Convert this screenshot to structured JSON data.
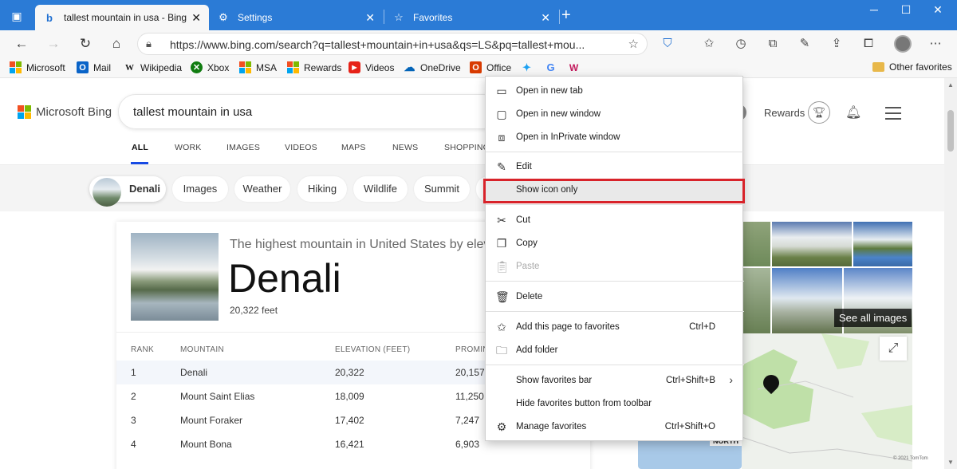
{
  "tabs": [
    {
      "title": "tallest mountain in usa - Bing",
      "icon": "bing-icon",
      "active": true
    },
    {
      "title": "Settings",
      "icon": "gear-icon",
      "active": false
    },
    {
      "title": "Favorites",
      "icon": "star-icon",
      "active": false
    }
  ],
  "address": {
    "url": "https://www.bing.com/search?q=tallest+mountain+in+usa&qs=LS&pq=tallest+mou..."
  },
  "favorites_bar": {
    "items": [
      "Microsoft",
      "Mail",
      "Wikipedia",
      "Xbox",
      "MSA",
      "Rewards",
      "Videos",
      "OneDrive",
      "Office"
    ],
    "other": "Other favorites"
  },
  "bing": {
    "logo_text": "Microsoft Bing",
    "query": "tallest mountain in usa",
    "rewards": "Rewards",
    "scopes": [
      "ALL",
      "WORK",
      "IMAGES",
      "VIDEOS",
      "MAPS",
      "NEWS",
      "SHOPPING"
    ],
    "chips": [
      "Denali",
      "Images",
      "Weather",
      "Hiking",
      "Wildlife",
      "Summit"
    ]
  },
  "answer": {
    "tagline": "The highest mountain in United States by elevation",
    "title": "Denali",
    "subtitle": "20,322 feet",
    "headers": [
      "RANK",
      "MOUNTAIN",
      "ELEVATION (FEET)",
      "PROMINENCE"
    ],
    "rows": [
      [
        "1",
        "Denali",
        "20,322",
        "20,157"
      ],
      [
        "2",
        "Mount Saint Elias",
        "18,009",
        "11,250"
      ],
      [
        "3",
        "Mount Foraker",
        "17,402",
        "7,247"
      ],
      [
        "4",
        "Mount Bona",
        "16,421",
        "6,903"
      ]
    ]
  },
  "images_panel": {
    "see_all": "See all images"
  },
  "map": {
    "north_label": "NORTH",
    "copyright": "© 2021 TomTom"
  },
  "context_menu": {
    "items": [
      {
        "label": "Open in new tab",
        "icon": "new-tab-icon"
      },
      {
        "label": "Open in new window",
        "icon": "new-window-icon"
      },
      {
        "label": "Open in InPrivate window",
        "icon": "inprivate-icon"
      },
      {
        "label": "Edit",
        "icon": "pencil-icon"
      },
      {
        "label": "Show icon only",
        "icon": "",
        "highlighted": true
      },
      {
        "label": "Cut",
        "icon": "scissors-icon"
      },
      {
        "label": "Copy",
        "icon": "copy-icon"
      },
      {
        "label": "Paste",
        "icon": "paste-icon",
        "disabled": true
      },
      {
        "label": "Delete",
        "icon": "trash-icon"
      },
      {
        "label": "Add this page to favorites",
        "icon": "add-favorite-icon",
        "shortcut": "Ctrl+D"
      },
      {
        "label": "Add folder",
        "icon": "add-folder-icon"
      },
      {
        "label": "Show favorites bar",
        "icon": "",
        "shortcut": "Ctrl+Shift+B",
        "submenu": true
      },
      {
        "label": "Hide favorites button from toolbar",
        "icon": ""
      },
      {
        "label": "Manage favorites",
        "icon": "gear-icon",
        "shortcut": "Ctrl+Shift+O"
      }
    ]
  },
  "colors": {
    "titlebar": "#2b7bd6",
    "highlight_box": "#d8232a",
    "bing_accent": "#174ae4"
  }
}
